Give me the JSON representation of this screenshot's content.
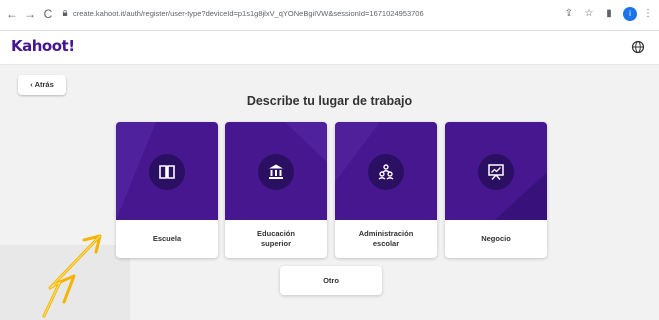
{
  "browser": {
    "url": "create.kahoot.it/auth/register/user-type?deviceId=p1s1g8jlxV_qYONeBgiIVW&sessionId=1671024953706",
    "profile_initial": "i"
  },
  "app": {
    "logo": "Kahoot!",
    "accent_color": "#46178f",
    "dark_accent": "#2a0f63"
  },
  "page": {
    "back_label": "Atrás",
    "title": "Describe tu lugar de trabajo",
    "cards": [
      {
        "label": "Escuela",
        "icon": "book-icon"
      },
      {
        "label": "Educación\nsuperior",
        "icon": "institution-icon"
      },
      {
        "label": "Administración\nescolar",
        "icon": "people-icon"
      },
      {
        "label": "Negocio",
        "icon": "presentation-icon"
      }
    ],
    "other_label": "Otro"
  },
  "annotation": {
    "arrow_color": "#f5b400",
    "arrow_icon": "hand-drawn-arrow-icon"
  }
}
